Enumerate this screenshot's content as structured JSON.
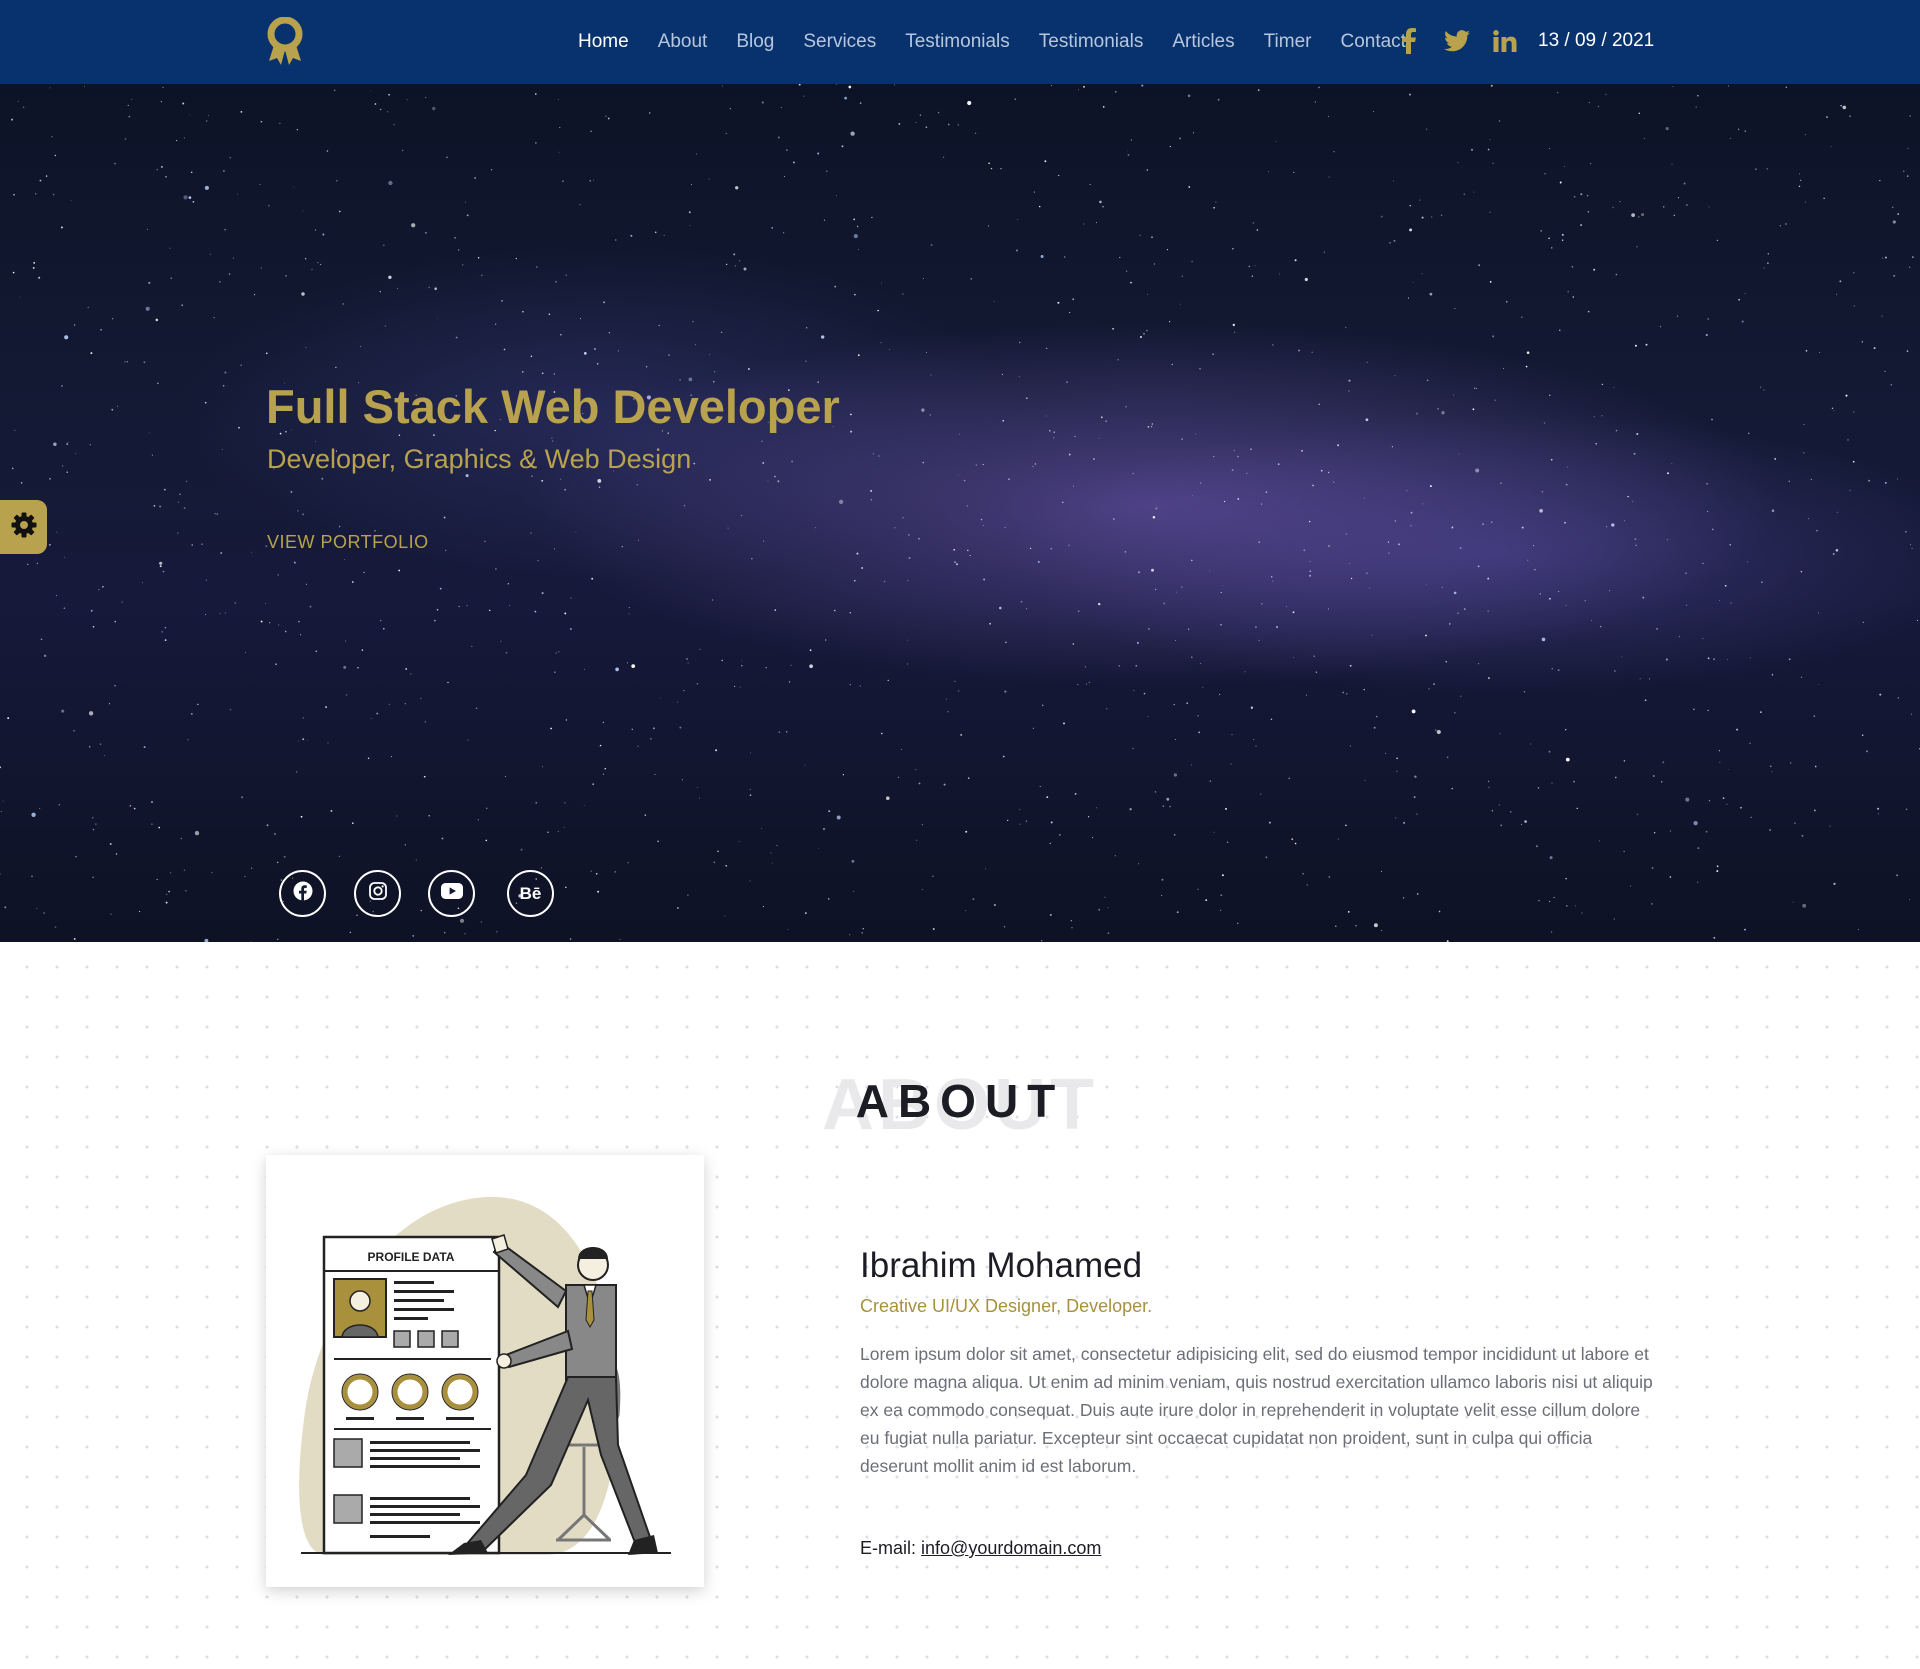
{
  "nav": {
    "links": [
      {
        "label": "Home",
        "active": true
      },
      {
        "label": "About"
      },
      {
        "label": "Blog"
      },
      {
        "label": "Services"
      },
      {
        "label": "Testimonials"
      },
      {
        "label": "Testimonials"
      },
      {
        "label": "Articles"
      },
      {
        "label": "Timer"
      },
      {
        "label": "Contact"
      }
    ],
    "social_icons": [
      "facebook-icon",
      "twitter-icon",
      "linkedin-icon"
    ],
    "date": "13 / 09 / 2021"
  },
  "hero": {
    "title": "Full Stack Web Developer",
    "subtitle": "Developer, Graphics & Web Design",
    "cta": "VIEW PORTFOLIO",
    "social_icons": [
      "facebook-icon",
      "instagram-icon",
      "youtube-icon",
      "behance-icon"
    ],
    "behance_glyph": "Bē"
  },
  "settings": {
    "icon": "gear-icon"
  },
  "about": {
    "ghost_heading": "ABOUT",
    "heading": "ABOUT",
    "illustration_label": "PROFILE DATA",
    "name": "Ibrahim Mohamed",
    "role": "Creative UI/UX Designer, Developer.",
    "description": "Lorem ipsum dolor sit amet, consectetur adipisicing elit, sed do eiusmod tempor incididunt ut labore et dolore magna aliqua. Ut enim ad minim veniam, quis nostrud exercitation ullamco laboris nisi ut aliquip ex ea commodo consequat. Duis aute irure dolor in reprehenderit in voluptate velit esse cillum dolore eu fugiat nulla pariatur. Excepteur sint occaecat cupidatat non proident, sunt in culpa qui officia deserunt mollit anim id est laborum.",
    "email_label": "E-mail:",
    "email": "info@yourdomain.com"
  },
  "colors": {
    "navbar": "#07326d",
    "accent": "#b9a24e",
    "text_dark": "#1c1d24",
    "text_muted": "#6c6f78"
  }
}
